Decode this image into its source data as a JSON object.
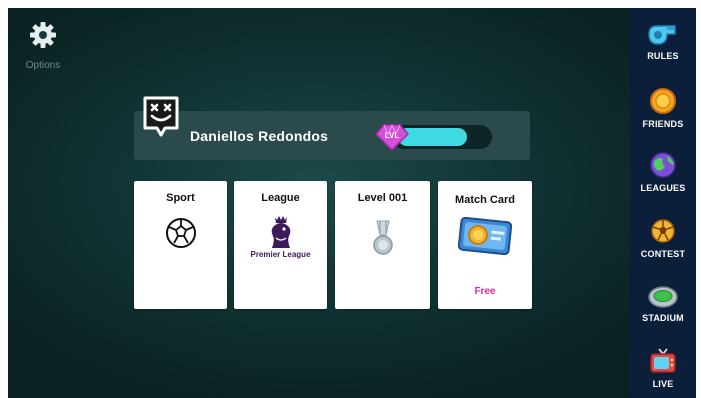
{
  "options": {
    "label": "Options",
    "icon": "gear-icon"
  },
  "profile": {
    "name": "Daniellos Redondos",
    "avatar_icon": "smiley-avatar-icon",
    "level_badge": "LVL",
    "level_progress": 0.78,
    "level_fill_color": "#3fd9e3"
  },
  "cards": [
    {
      "title": "Sport",
      "icon": "soccer-ball-icon"
    },
    {
      "title": "League",
      "icon": "premier-league-logo",
      "logo_text": "Premier League"
    },
    {
      "title": "Level 001",
      "icon": "medal-icon"
    },
    {
      "title": "Match Card",
      "icon": "match-card-icon",
      "price": "Free"
    }
  ],
  "sidebar": {
    "items": [
      {
        "label": "RULES",
        "icon": "whistle-icon"
      },
      {
        "label": "FRIENDS",
        "icon": "coin-icon"
      },
      {
        "label": "LEAGUES",
        "icon": "globe-icon"
      },
      {
        "label": "CONTEST",
        "icon": "trophy-ball-icon"
      },
      {
        "label": "STADIUM",
        "icon": "stadium-icon"
      },
      {
        "label": "LIVE",
        "icon": "tv-icon"
      }
    ]
  },
  "colors": {
    "background": "#0b2424",
    "sidebar": "#0b1f3a",
    "free_text": "#e0279d",
    "badge": "#d34fd8"
  }
}
